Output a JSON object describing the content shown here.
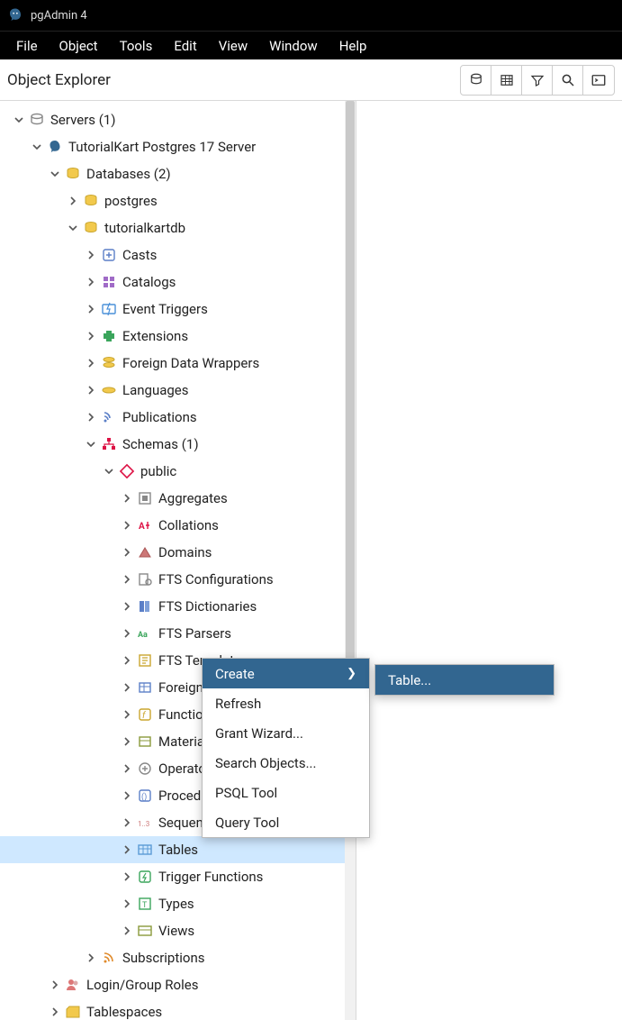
{
  "app": {
    "title": "pgAdmin 4"
  },
  "menubar": [
    "File",
    "Object",
    "Tools",
    "Edit",
    "View",
    "Window",
    "Help"
  ],
  "explorer": {
    "title": "Object Explorer",
    "toolbar_icons": [
      "database-icon",
      "table-icon",
      "filter-icon",
      "search-icon",
      "terminal-icon"
    ]
  },
  "tree": {
    "servers_label": "Servers (1)",
    "server_name": "TutorialKart Postgres 17 Server",
    "databases_label": "Databases (2)",
    "db1": "postgres",
    "db2": "tutorialkartdb",
    "db2_children": [
      "Casts",
      "Catalogs",
      "Event Triggers",
      "Extensions",
      "Foreign Data Wrappers",
      "Languages",
      "Publications"
    ],
    "schemas_label": "Schemas (1)",
    "schema_public": "public",
    "public_children_a": [
      "Aggregates",
      "Collations",
      "Domains",
      "FTS Configurations",
      "FTS Dictionaries",
      "FTS Parsers",
      "FTS Templates",
      "Foreign Tables",
      "Functions",
      "Materialized Views",
      "Operators",
      "Procedures",
      "Sequences"
    ],
    "tables_label": "Tables",
    "public_children_b": [
      "Trigger Functions",
      "Types",
      "Views"
    ],
    "subscriptions": "Subscriptions",
    "login_roles": "Login/Group Roles",
    "tablespaces": "Tablespaces"
  },
  "context_menu": {
    "items": [
      "Create",
      "Refresh",
      "Grant Wizard...",
      "Search Objects...",
      "PSQL Tool",
      "Query Tool"
    ],
    "active": "Create",
    "submenu_item": "Table..."
  },
  "truncated": {
    "t6": "FTS Templates",
    "t7": "Foreign Tables",
    "t8": "Functions",
    "t9": "Materialized Views",
    "t10": "Operators",
    "t11": "Procedures",
    "t12": "Sequences"
  }
}
